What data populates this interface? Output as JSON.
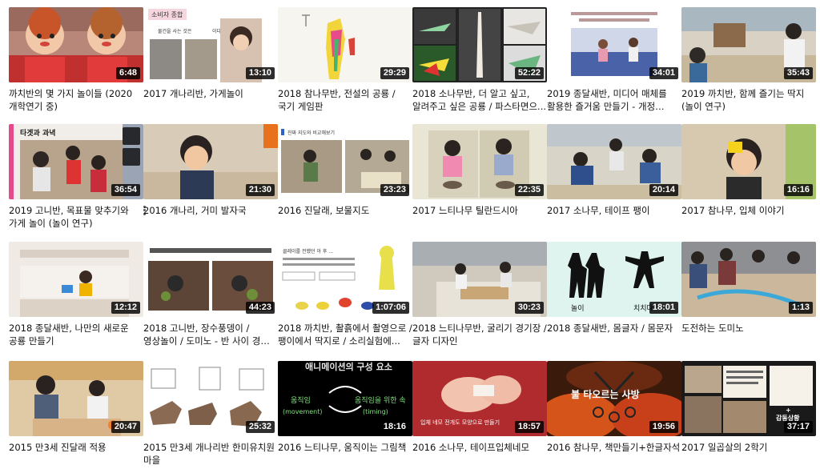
{
  "videos": [
    {
      "title": "까치반의 몇 가지 놀이들 (2020 개학연기 중)",
      "duration": "6:48"
    },
    {
      "title": "2017 개나리반, 가게놀이",
      "duration": "13:10",
      "overlay_text": [
        "소비자 종합",
        "물건을 사는 것은",
        "이다."
      ]
    },
    {
      "title": "2018 참나무반, 전설의 공룡 / 국기 게임판",
      "duration": "29:29"
    },
    {
      "title": "2018 소나무반, 더 알고 싶고, 알려주고 싶은 공룡 / 파스타면으...",
      "duration": "52:22"
    },
    {
      "title": "2019 종달새반, 미디어 매체를 활용한 즐거움 만들기 - 개정 누리...",
      "duration": "34:01"
    },
    {
      "title": "2019 까치반, 함께 즐기는 딱지 (놀이 연구)",
      "duration": "35:43"
    },
    {
      "title": "2019 고니반, 목표물 맞추기와 가게 놀이 (놀이 연구)",
      "duration": "36:54",
      "overlay_text": [
        "타겟과 과녁"
      ]
    },
    {
      "title": "2016 개나리, 거미 발자국",
      "duration": "21:30"
    },
    {
      "title": "2016 진달래, 보물지도",
      "duration": "23:23",
      "overlay_text": [
        "진짜 지도와 비교해보기"
      ]
    },
    {
      "title": "2017 느티나무 틸란드시아",
      "duration": "22:35"
    },
    {
      "title": "2017 소나무, 테이프 팽이",
      "duration": "20:14"
    },
    {
      "title": "2017 참나무, 입체 이야기",
      "duration": "16:16"
    },
    {
      "title": "2018 종달새반, 나만의 새로운 공룡 만들기",
      "duration": "12:12"
    },
    {
      "title": "2018 고니반, 장수풍뎅이 / 영상놀이 / 도미노 - 반 사이 경계를 ...",
      "duration": "44:23"
    },
    {
      "title": "2018 까치반, 촬흙에서 촬영으로 / 팽이에서 딱지로 / 소리실험에...",
      "duration": "1:07:06",
      "overlay_text": [
        "클레이를 전했던 아 후 ..."
      ]
    },
    {
      "title": "2018 느티나무반, 굴리기 경기장 / 글자 디자인",
      "duration": "30:23"
    },
    {
      "title": "2018 종달새반, 몸글자 / 몸문자",
      "duration": "18:01",
      "overlay_text": [
        "놀이",
        "치치다"
      ]
    },
    {
      "title": "도전하는 도미노",
      "duration": "1:13"
    },
    {
      "title": "2015 만3세 진달래 적용",
      "duration": "20:47"
    },
    {
      "title": "2015 만3세 개나리반 한미유치원 마을",
      "duration": "25:32"
    },
    {
      "title": "2016 느티나무, 움직이는 그림책",
      "duration": "18:16",
      "overlay_text": [
        "애니메이션의 구성 요소",
        "움직임",
        "(movement)",
        "움직임을 위한 속",
        "(timing)"
      ]
    },
    {
      "title": "2016 소나무, 테이프입체네모",
      "duration": "18:57",
      "overlay_text": [
        "입체 네모 전개도 모양으로 만들기"
      ]
    },
    {
      "title": "2016 참나무, 책만들기+한글자석",
      "duration": "19:56",
      "overlay_text": [
        "불 타오르는 사방"
      ]
    },
    {
      "title": "2017 일곱살의 2학기",
      "duration": "37:17",
      "overlay_text": [
        "+",
        "감동상황"
      ]
    }
  ],
  "colors": {
    "duration_bg": "#000000",
    "title": "#111111"
  },
  "icons": [
    "clock-icon",
    "queue-icon",
    "more-vert-icon"
  ]
}
